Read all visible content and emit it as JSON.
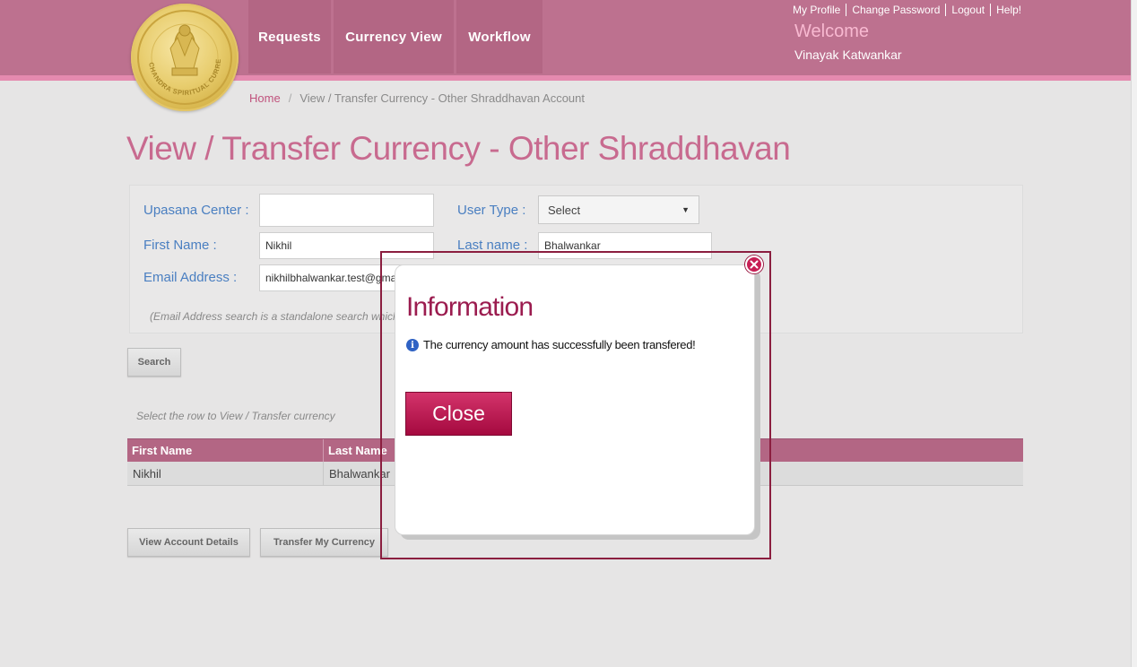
{
  "header": {
    "logo_text": "CHANDRA SPIRITUAL CURRENCY",
    "nav": [
      "Requests",
      "Currency View",
      "Workflow"
    ],
    "top_links": [
      "My Profile",
      "Change Password",
      "Logout",
      "Help!"
    ],
    "welcome": "Welcome",
    "user_name": "Vinayak Katwankar"
  },
  "breadcrumb": {
    "home": "Home",
    "separator": "/",
    "current": "View / Transfer Currency - Other Shraddhavan Account"
  },
  "page_title": "View / Transfer Currency - Other Shraddhavan",
  "form": {
    "upasana_center_label": "Upasana Center :",
    "upasana_center_value": "",
    "user_type_label": "User Type :",
    "user_type_value": "Select",
    "first_name_label": "First Name :",
    "first_name_value": "Nikhil",
    "last_name_label": "Last name :",
    "last_name_value": "Bhalwankar",
    "email_label": "Email Address :",
    "email_value": "nikhilbhalwankar.test@gmail.com",
    "note": "(Email Address search is a standalone search which"
  },
  "search_button": "Search",
  "hint": "Select the row to View / Transfer currency",
  "table": {
    "columns": [
      "First Name",
      "Last Name"
    ],
    "rows": [
      [
        "Nikhil",
        "Bhalwankar"
      ]
    ]
  },
  "actions": {
    "view_account": "View Account Details",
    "transfer": "Transfer My Currency"
  },
  "modal": {
    "title": "Information",
    "message": "The currency amount has successfully been transfered!",
    "close_label": "Close"
  },
  "colors": {
    "header": "#bd718f",
    "accent": "#c0537d",
    "modal_title": "#9b1c4f",
    "close_button": "#c0155a",
    "highlight_border": "#8b1e3f"
  }
}
